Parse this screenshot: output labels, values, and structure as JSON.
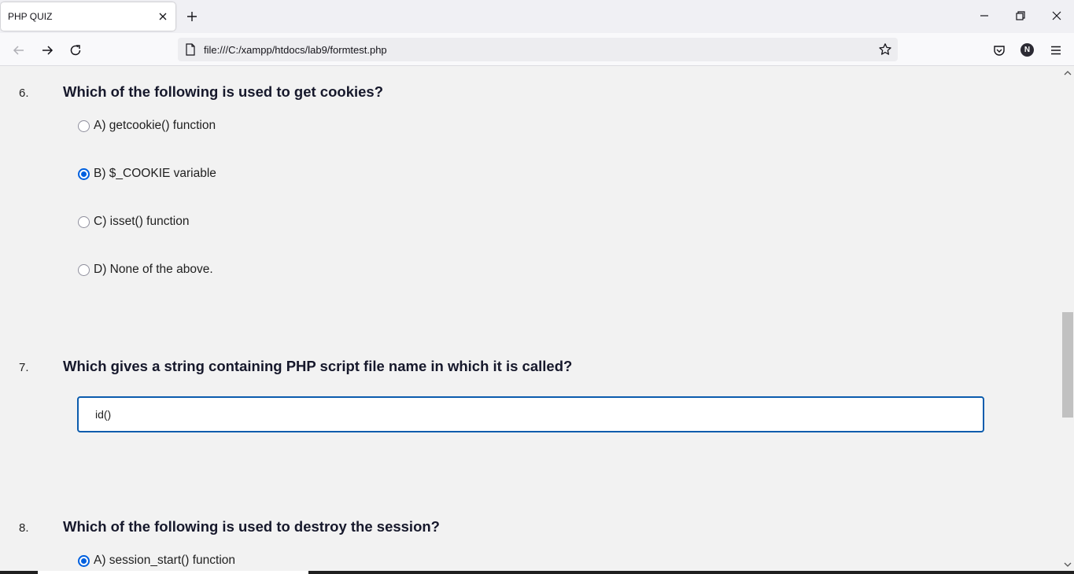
{
  "browser": {
    "tab_title": "PHP QUIZ",
    "url": "file:///C:/xampp/htdocs/lab9/formtest.php",
    "profile_initial": "N"
  },
  "quiz": {
    "q6": {
      "number": "6.",
      "text": "Which of the following is used to get cookies?",
      "options": [
        {
          "label": "A) getcookie() function",
          "checked": false
        },
        {
          "label": "B) $_COOKIE variable",
          "checked": true
        },
        {
          "label": "C) isset() function",
          "checked": false
        },
        {
          "label": "D) None of the above.",
          "checked": false
        }
      ]
    },
    "q7": {
      "number": "7.",
      "text": "Which gives a string containing PHP script file name in which it is called?",
      "answer_value": "id()"
    },
    "q8": {
      "number": "8.",
      "text": "Which of the following is used to destroy the session?",
      "options": [
        {
          "label": "A) session_start() function",
          "checked": true
        }
      ]
    }
  },
  "colors": {
    "accent": "#0060df",
    "input_border": "#0b5cad",
    "page_bg": "#f2f2f2"
  }
}
